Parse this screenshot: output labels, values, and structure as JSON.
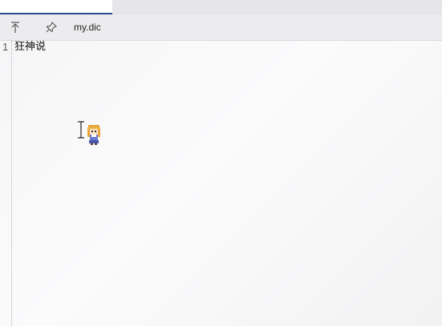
{
  "toolbar": {
    "move_top_icon": "arrow-to-top-icon",
    "pin_icon": "pin-icon",
    "file_name": "my.dic"
  },
  "editor": {
    "lines": [
      {
        "number": "1",
        "text": "狂神说"
      }
    ]
  },
  "colors": {
    "tab_accent": "#2b4c8a",
    "toolbar_bg": "#ececee",
    "editor_bg": "#f6f6f7"
  }
}
